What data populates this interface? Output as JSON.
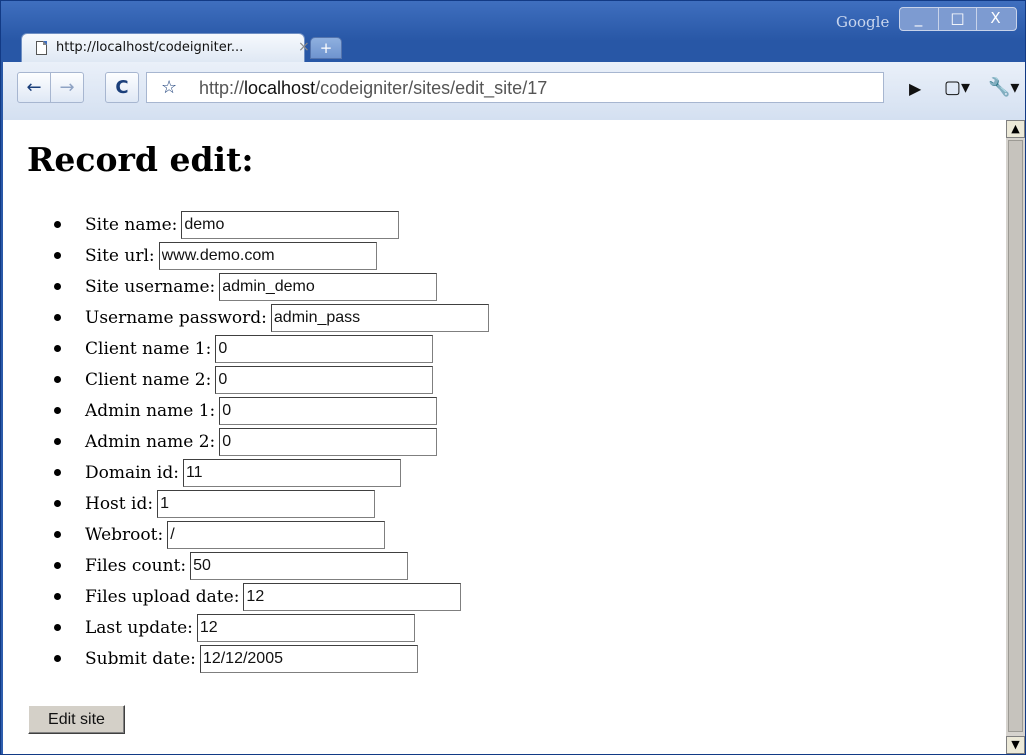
{
  "browser": {
    "tab_title": "http://localhost/codeigniter...",
    "tab_close": "×",
    "new_tab": "+",
    "brand": "Google",
    "window_buttons": {
      "min": "_",
      "max": "□",
      "close": "X"
    },
    "nav": {
      "back": "←",
      "forward": "→",
      "reload": "C",
      "star": "☆"
    },
    "url_prefix": "http://",
    "url_host": "localhost",
    "url_path": "/codeigniter/sites/edit_site/17",
    "icons": {
      "go": "▶",
      "page": "▢▾",
      "wrench": "🔧▾"
    }
  },
  "page": {
    "title": "Record edit:",
    "fields": [
      {
        "label": "Site name:",
        "value": "demo"
      },
      {
        "label": "Site url:",
        "value": "www.demo.com"
      },
      {
        "label": "Site username:",
        "value": "admin_demo"
      },
      {
        "label": "Username password:",
        "value": "admin_pass"
      },
      {
        "label": "Client name 1:",
        "value": "0"
      },
      {
        "label": "Client name 2:",
        "value": "0"
      },
      {
        "label": "Admin name 1:",
        "value": "0"
      },
      {
        "label": "Admin name 2:",
        "value": "0"
      },
      {
        "label": "Domain id:",
        "value": "11"
      },
      {
        "label": "Host id:",
        "value": "1"
      },
      {
        "label": "Webroot:",
        "value": "/"
      },
      {
        "label": "Files count:",
        "value": "50"
      },
      {
        "label": "Files upload date:",
        "value": "12"
      },
      {
        "label": "Last update:",
        "value": "12"
      },
      {
        "label": "Submit date:",
        "value": "12/12/2005"
      }
    ],
    "submit_label": "Edit site"
  },
  "scrollbar": {
    "up": "▲",
    "down": "▼"
  }
}
